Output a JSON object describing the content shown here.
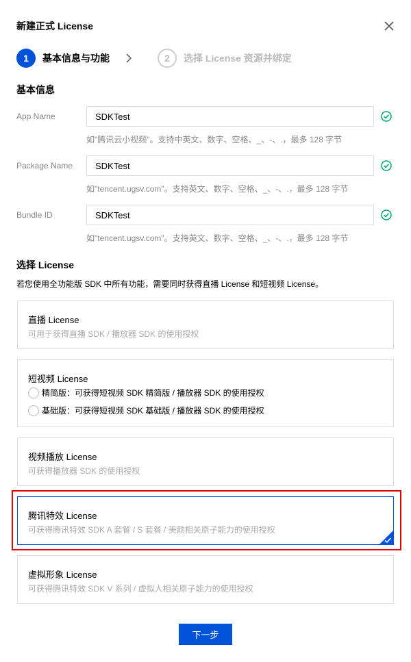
{
  "dialog": {
    "title": "新建正式 License"
  },
  "steps": [
    {
      "number": "1",
      "label": "基本信息与功能",
      "state": "active"
    },
    {
      "number": "2",
      "label": "选择 License 资源并绑定",
      "state": "inactive"
    }
  ],
  "basic_info": {
    "section_title": "基本信息",
    "fields": [
      {
        "label": "App Name",
        "value": "SDKTest",
        "help": "如\"腾讯云小视频\"。支持中英文、数字、空格、_、-、.，最多 128 字节"
      },
      {
        "label": "Package Name",
        "value": "SDKTest",
        "help": "如\"tencent.ugsv.com\"。支持英文、数字、空格、_、-、.，最多 128 字节"
      },
      {
        "label": "Bundle ID",
        "value": "SDKTest",
        "help": "如\"tencent.ugsv.com\"。支持英文、数字、空格、_、-、.，最多 128 字节"
      }
    ]
  },
  "license_select": {
    "section_title": "选择 License",
    "description": "若您使用全功能版 SDK 中所有功能，需要同时获得直播 License 和短视频 License。",
    "cards": [
      {
        "title": "直播 License",
        "subtitle": "可用于获得直播 SDK / 播放器 SDK 的使用授权"
      },
      {
        "title": "短视频 License",
        "options": [
          "精简版：可获得短视频 SDK 精简版 / 播放器 SDK 的使用授权",
          "基础版：可获得短视频 SDK 基础版 / 播放器 SDK 的使用授权"
        ]
      },
      {
        "title": "视频播放 License",
        "subtitle": "可获得播放器 SDK 的使用授权"
      },
      {
        "title": "腾讯特效 License",
        "subtitle": "可获得腾讯特效 SDK A 套餐 / S 套餐 / 美颜相关原子能力的使用授权",
        "selected": true
      },
      {
        "title": "虚拟形象 License",
        "subtitle": "可获得腾讯特效 SDK V 系列 / 虚拟人相关原子能力的使用授权"
      }
    ]
  },
  "footer": {
    "next_label": "下一步"
  },
  "colors": {
    "primary": "#0052d9",
    "success": "#00a870",
    "highlight": "#e20000"
  }
}
